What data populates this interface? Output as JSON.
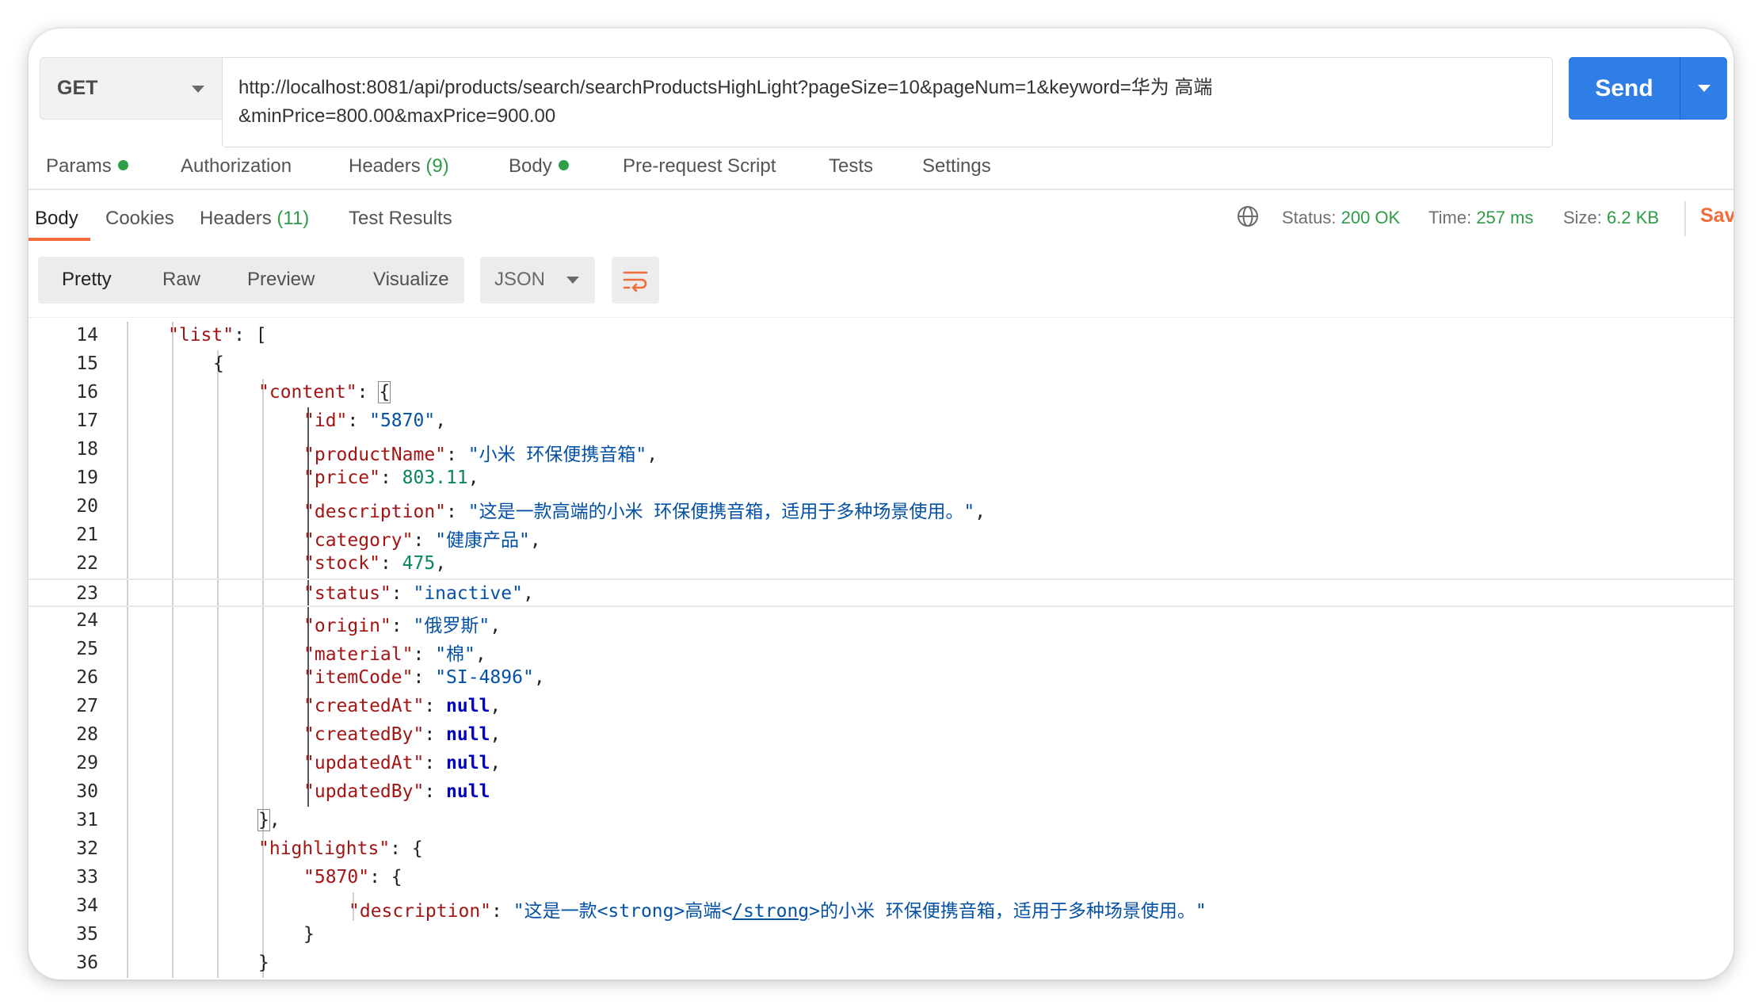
{
  "request": {
    "method": "GET",
    "url_line1": "http://localhost:8081/api/products/search/searchProductsHighLight?pageSize=10&pageNum=1&keyword=华为 高端",
    "url_line2": "&minPrice=800.00&maxPrice=900.00",
    "send_label": "Send"
  },
  "request_tabs": [
    {
      "label": "Params",
      "dot": true
    },
    {
      "label": "Authorization"
    },
    {
      "label": "Headers",
      "count": "(9)"
    },
    {
      "label": "Body",
      "dot": true
    },
    {
      "label": "Pre-request Script"
    },
    {
      "label": "Tests"
    },
    {
      "label": "Settings"
    }
  ],
  "response_tabs": [
    {
      "label": "Body",
      "active": true
    },
    {
      "label": "Cookies"
    },
    {
      "label": "Headers",
      "count": "(11)"
    },
    {
      "label": "Test Results"
    }
  ],
  "response_meta": {
    "status_label": "Status:",
    "status_value": "200 OK",
    "time_label": "Time:",
    "time_value": "257 ms",
    "size_label": "Size:",
    "size_value": "6.2 KB",
    "save_label": "Sav"
  },
  "view_modes": [
    "Pretty",
    "Raw",
    "Preview",
    "Visualize"
  ],
  "active_view_mode": "Pretty",
  "format": "JSON",
  "icons": {
    "globe": "globe-icon",
    "wrap": "wrap-lines-icon",
    "dropdown": "chevron-down-icon"
  },
  "colors": {
    "accent_orange": "#f26b3a",
    "send_blue": "#2f7ee6",
    "status_green": "#2d9c46"
  },
  "code_lines": [
    {
      "n": "14",
      "indent": 4,
      "tokens": [
        [
          "k",
          "\"list\""
        ],
        [
          "p",
          ": ["
        ]
      ]
    },
    {
      "n": "15",
      "indent": 5,
      "tokens": [
        [
          "p",
          "{"
        ]
      ]
    },
    {
      "n": "16",
      "indent": 6,
      "tokens": [
        [
          "k",
          "\"content\""
        ],
        [
          "p",
          ": "
        ],
        [
          "p",
          "{",
          "box"
        ]
      ]
    },
    {
      "n": "17",
      "indent": 7,
      "tokens": [
        [
          "k",
          "\"id\""
        ],
        [
          "p",
          ": "
        ],
        [
          "s",
          "\"5870\""
        ],
        [
          "p",
          ","
        ]
      ]
    },
    {
      "n": "18",
      "indent": 7,
      "tokens": [
        [
          "k",
          "\"productName\""
        ],
        [
          "p",
          ": "
        ],
        [
          "s",
          "\"小米 环保便携音箱\""
        ],
        [
          "p",
          ","
        ]
      ]
    },
    {
      "n": "19",
      "indent": 7,
      "tokens": [
        [
          "k",
          "\"price\""
        ],
        [
          "p",
          ": "
        ],
        [
          "n",
          "803.11"
        ],
        [
          "p",
          ","
        ]
      ]
    },
    {
      "n": "20",
      "indent": 7,
      "tokens": [
        [
          "k",
          "\"description\""
        ],
        [
          "p",
          ": "
        ],
        [
          "s",
          "\"这是一款高端的小米 环保便携音箱，适用于多种场景使用。\""
        ],
        [
          "p",
          ","
        ]
      ]
    },
    {
      "n": "21",
      "indent": 7,
      "tokens": [
        [
          "k",
          "\"category\""
        ],
        [
          "p",
          ": "
        ],
        [
          "s",
          "\"健康产品\""
        ],
        [
          "p",
          ","
        ]
      ]
    },
    {
      "n": "22",
      "indent": 7,
      "tokens": [
        [
          "k",
          "\"stock\""
        ],
        [
          "p",
          ": "
        ],
        [
          "n",
          "475"
        ],
        [
          "p",
          ","
        ]
      ]
    },
    {
      "n": "23",
      "indent": 7,
      "highlight": true,
      "tokens": [
        [
          "k",
          "\"status\""
        ],
        [
          "p",
          ": "
        ],
        [
          "s",
          "\"inactive\""
        ],
        [
          "p",
          ","
        ]
      ]
    },
    {
      "n": "24",
      "indent": 7,
      "tokens": [
        [
          "k",
          "\"origin\""
        ],
        [
          "p",
          ": "
        ],
        [
          "s",
          "\"俄罗斯\""
        ],
        [
          "p",
          ","
        ]
      ]
    },
    {
      "n": "25",
      "indent": 7,
      "tokens": [
        [
          "k",
          "\"material\""
        ],
        [
          "p",
          ": "
        ],
        [
          "s",
          "\"棉\""
        ],
        [
          "p",
          ","
        ]
      ]
    },
    {
      "n": "26",
      "indent": 7,
      "tokens": [
        [
          "k",
          "\"itemCode\""
        ],
        [
          "p",
          ": "
        ],
        [
          "s",
          "\"SI-4896\""
        ],
        [
          "p",
          ","
        ]
      ]
    },
    {
      "n": "27",
      "indent": 7,
      "tokens": [
        [
          "k",
          "\"createdAt\""
        ],
        [
          "p",
          ": "
        ],
        [
          "kw",
          "null"
        ],
        [
          "p",
          ","
        ]
      ]
    },
    {
      "n": "28",
      "indent": 7,
      "tokens": [
        [
          "k",
          "\"createdBy\""
        ],
        [
          "p",
          ": "
        ],
        [
          "kw",
          "null"
        ],
        [
          "p",
          ","
        ]
      ]
    },
    {
      "n": "29",
      "indent": 7,
      "tokens": [
        [
          "k",
          "\"updatedAt\""
        ],
        [
          "p",
          ": "
        ],
        [
          "kw",
          "null"
        ],
        [
          "p",
          ","
        ]
      ]
    },
    {
      "n": "30",
      "indent": 7,
      "tokens": [
        [
          "k",
          "\"updatedBy\""
        ],
        [
          "p",
          ": "
        ],
        [
          "kw",
          "null"
        ]
      ]
    },
    {
      "n": "31",
      "indent": 6,
      "tokens": [
        [
          "p",
          "}",
          "box"
        ],
        [
          "p",
          ","
        ]
      ]
    },
    {
      "n": "32",
      "indent": 6,
      "tokens": [
        [
          "k",
          "\"highlights\""
        ],
        [
          "p",
          ": {"
        ]
      ]
    },
    {
      "n": "33",
      "indent": 7,
      "tokens": [
        [
          "k",
          "\"5870\""
        ],
        [
          "p",
          ": {"
        ]
      ]
    },
    {
      "n": "34",
      "indent": 8,
      "tokens": [
        [
          "k",
          "\"description\""
        ],
        [
          "p",
          ": "
        ],
        [
          "s",
          "\"这是一款<strong>高端<"
        ],
        [
          "s",
          "/strong",
          "u"
        ],
        [
          "s",
          ">的小米 环保便携音箱，适用于多种场景使用。\""
        ]
      ]
    },
    {
      "n": "35",
      "indent": 7,
      "tokens": [
        [
          "p",
          "}"
        ]
      ]
    },
    {
      "n": "36",
      "indent": 6,
      "tokens": [
        [
          "p",
          "}"
        ]
      ]
    }
  ]
}
